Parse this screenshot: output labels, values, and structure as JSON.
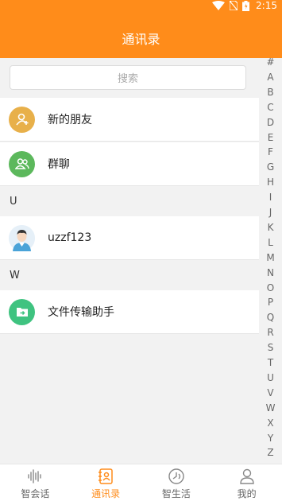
{
  "status_bar": {
    "time": "2:15"
  },
  "header": {
    "title": "通讯录"
  },
  "search": {
    "placeholder": "搜索"
  },
  "top_items": [
    {
      "label": "新的朋友",
      "icon": "add-user-icon",
      "color": "#e8b04a"
    },
    {
      "label": "群聊",
      "icon": "group-icon",
      "color": "#5cb85c"
    }
  ],
  "sections": [
    {
      "letter": "U",
      "contacts": [
        {
          "name": "uzzf123",
          "icon": "avatar-icon"
        }
      ]
    },
    {
      "letter": "W",
      "contacts": [
        {
          "name": "文件传输助手",
          "icon": "file-transfer-icon",
          "color": "#3fc380"
        }
      ]
    }
  ],
  "index_letters": [
    "#",
    "A",
    "B",
    "C",
    "D",
    "E",
    "F",
    "G",
    "H",
    "I",
    "J",
    "K",
    "L",
    "M",
    "N",
    "O",
    "P",
    "Q",
    "R",
    "S",
    "T",
    "U",
    "V",
    "W",
    "X",
    "Y",
    "Z"
  ],
  "bottom_nav": [
    {
      "label": "智会话",
      "icon": "waveform-icon",
      "active": false
    },
    {
      "label": "通讯录",
      "icon": "contacts-book-icon",
      "active": true
    },
    {
      "label": "智生活",
      "icon": "life-icon",
      "active": false
    },
    {
      "label": "我的",
      "icon": "profile-icon",
      "active": false
    }
  ],
  "colors": {
    "accent": "#ff8c1a",
    "background": "#f2f2f2"
  }
}
